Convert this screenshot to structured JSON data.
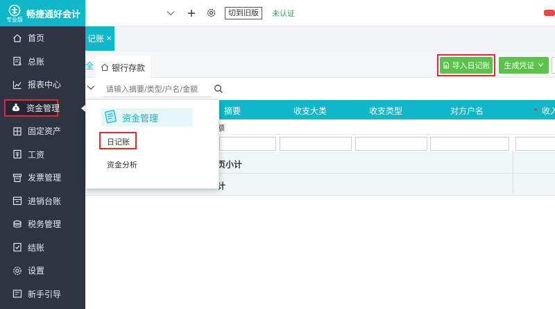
{
  "app": {
    "name": "畅捷通好会计",
    "edition": "专业版"
  },
  "sidebar": {
    "items": [
      {
        "label": "首页",
        "icon": "home-icon"
      },
      {
        "label": "总账",
        "icon": "ledger-icon"
      },
      {
        "label": "报表中心",
        "icon": "chart-icon"
      },
      {
        "label": "资金管理",
        "icon": "money-bag-icon",
        "active": true
      },
      {
        "label": "固定资产",
        "icon": "building-icon"
      },
      {
        "label": "工资",
        "icon": "wallet-icon"
      },
      {
        "label": "发票管理",
        "icon": "invoice-icon"
      },
      {
        "label": "进销台账",
        "icon": "box-icon"
      },
      {
        "label": "税务管理",
        "icon": "tax-icon"
      },
      {
        "label": "结账",
        "icon": "checkout-icon"
      },
      {
        "label": "设置",
        "icon": "gear-icon"
      },
      {
        "label": "新手引导",
        "icon": "guide-icon"
      }
    ]
  },
  "topbar": {
    "switch_label": "切到旧版",
    "status": "未认证"
  },
  "open_tab": {
    "label": "记账",
    "close": "×"
  },
  "subtabs": {
    "partial": "全",
    "bank_label": "银行存款"
  },
  "actions": {
    "import_label": "导入日记账",
    "generate_label": "生成凭证"
  },
  "filter": {
    "placeholder": "请输入摘要/类型/户名/金额"
  },
  "table": {
    "columns": [
      "摘要",
      "收支大类",
      "收支类型",
      "对方户名",
      "收入"
    ],
    "balance_row": "额",
    "subtotal_row": "页小计",
    "total_row": "计"
  },
  "flyout": {
    "title": "资金管理",
    "items": [
      "日记账",
      "资金分析"
    ]
  },
  "colors": {
    "accent": "#0fb8c9",
    "sidebar_bg": "#2e3442",
    "button_green": "#5cc34a",
    "highlight_red": "#e52a2a"
  }
}
